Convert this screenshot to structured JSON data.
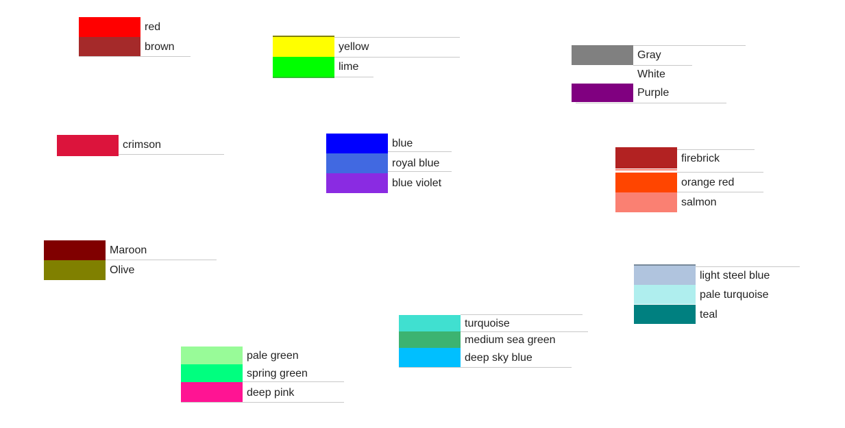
{
  "groups": [
    {
      "items": [
        {
          "label": "red",
          "color": "#ff0000"
        },
        {
          "label": "brown",
          "color": "#a52a2a"
        }
      ]
    },
    {
      "items": [
        {
          "label": "yellow",
          "color": "#ffff00"
        },
        {
          "label": "lime",
          "color": "#00ff00"
        }
      ]
    },
    {
      "items": [
        {
          "label": "Gray",
          "color": "#808080"
        },
        {
          "label": "White",
          "color": "#ffffff"
        },
        {
          "label": "Purple",
          "color": "#800080"
        }
      ]
    },
    {
      "items": [
        {
          "label": "crimson",
          "color": "#dc143c"
        }
      ]
    },
    {
      "items": [
        {
          "label": "blue",
          "color": "#0000ff"
        },
        {
          "label": "royal blue",
          "color": "#4169e1"
        },
        {
          "label": "blue violet",
          "color": "#8a2be2"
        }
      ]
    },
    {
      "items": [
        {
          "label": "firebrick",
          "color": "#b22222"
        },
        {
          "label": "orange red",
          "color": "#ff4500"
        },
        {
          "label": "salmon",
          "color": "#fa8072"
        }
      ]
    },
    {
      "items": [
        {
          "label": "Maroon",
          "color": "#800000"
        },
        {
          "label": "Olive",
          "color": "#808000"
        }
      ]
    },
    {
      "items": [
        {
          "label": "light steel blue",
          "color": "#b0c4de"
        },
        {
          "label": "pale turquoise",
          "color": "#afeeee"
        },
        {
          "label": "teal",
          "color": "#008080"
        }
      ]
    },
    {
      "items": [
        {
          "label": "turquoise",
          "color": "#40e0d0"
        },
        {
          "label": "medium sea green",
          "color": "#3cb371"
        },
        {
          "label": "deep sky blue",
          "color": "#00bfff"
        }
      ]
    },
    {
      "items": [
        {
          "label": "pale green",
          "color": "#98fb98"
        },
        {
          "label": "spring green",
          "color": "#00ff7f"
        },
        {
          "label": "deep pink",
          "color": "#ff1493"
        }
      ]
    }
  ]
}
